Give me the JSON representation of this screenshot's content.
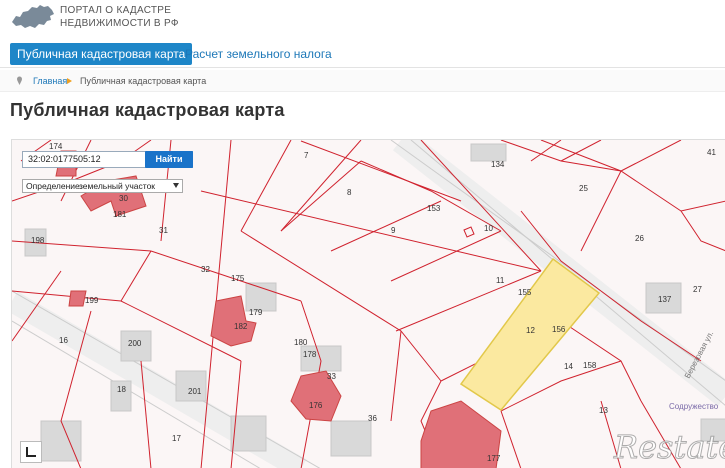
{
  "header": {
    "logo_icon": "russia-map-icon",
    "brand_line1": "ПОРТАЛ О КАДАСТРЕ",
    "brand_line2": "НЕДВИЖИМОСТИ В РФ"
  },
  "tabs": [
    {
      "label": "Публичная кадастровая карта",
      "active": true
    },
    {
      "label": "Расчет земельного налога",
      "active": false
    }
  ],
  "breadcrumb": {
    "home": "Главная",
    "current": "Публичная кадастровая карта"
  },
  "page_title": "Публичная кадастровая карта",
  "map": {
    "search_value": "32:02:0177505:12",
    "find_label": "Найти",
    "definition_label": "Определение:",
    "definition_value": "земельный участок",
    "street_label": "Березовая ул.",
    "street_label2": "Содружество",
    "watermark": "Restate",
    "parcel_labels": [
      "7",
      "8",
      "9",
      "10",
      "11",
      "12",
      "13",
      "14",
      "16",
      "17",
      "18",
      "25",
      "26",
      "27",
      "30",
      "31",
      "32",
      "33",
      "36",
      "41",
      "134",
      "137",
      "153",
      "155",
      "156",
      "158",
      "174",
      "175",
      "176",
      "177",
      "178",
      "179",
      "180",
      "181",
      "182",
      "198",
      "199",
      "200",
      "201"
    ],
    "colors": {
      "boundary": "#d0222e",
      "building_fill": "#e07078",
      "selected_fill": "#fbe9a0",
      "selected_stroke": "#e2c84a",
      "structure": "#d6d6d6"
    }
  },
  "map_controls": {
    "layers_icon": "layers-toggle-icon"
  }
}
